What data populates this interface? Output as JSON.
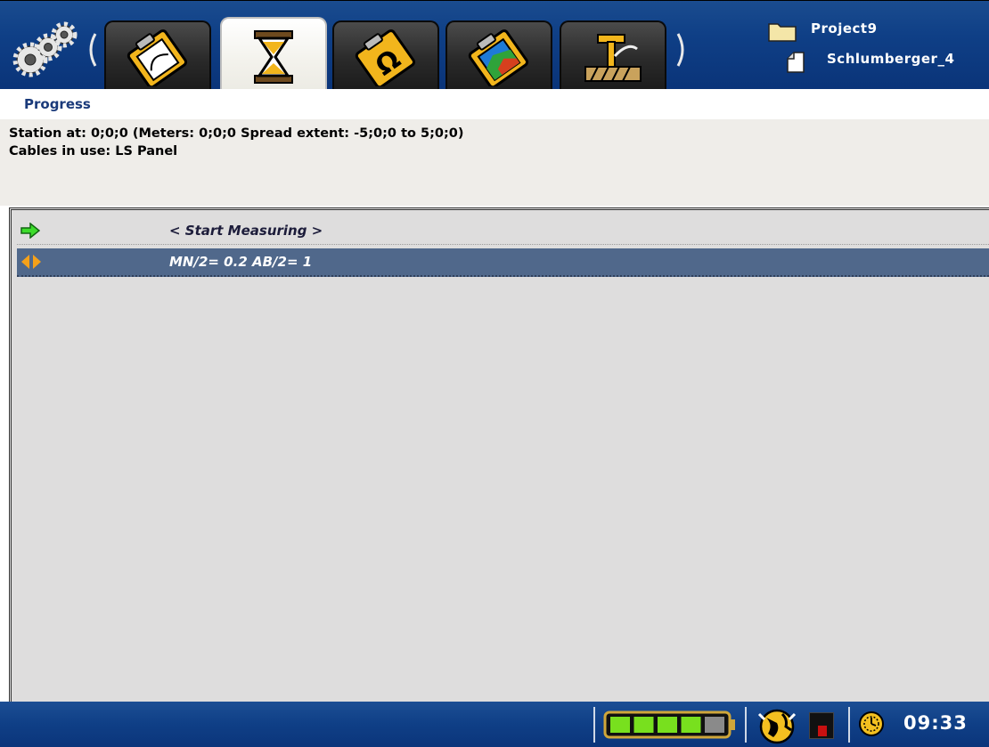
{
  "header": {
    "project_name": "Project9",
    "file_name": "Schlumberger_4",
    "tabs": [
      {
        "icon": "clipboard-curve-icon",
        "active": false
      },
      {
        "icon": "hourglass-icon",
        "active": true
      },
      {
        "icon": "clipboard-ohm-icon",
        "active": false
      },
      {
        "icon": "clipboard-map-icon",
        "active": false
      },
      {
        "icon": "electrode-stake-icon",
        "active": false
      }
    ]
  },
  "page": {
    "title": "Progress",
    "station_line": "Station at: 0;0;0 (Meters: 0;0;0 Spread extent: -5;0;0 to 5;0;0)",
    "cables_line": "Cables in use: LS Panel"
  },
  "list": {
    "rows": [
      {
        "label": "< Start Measuring >",
        "icon": "green-arrow-icon",
        "selected": false
      },
      {
        "label": "MN/2= 0.2 AB/2= 1",
        "icon": "orange-diamond-icon",
        "selected": true
      }
    ]
  },
  "statusbar": {
    "battery_level_segments": 4,
    "battery_total_segments": 5,
    "time": "09:33"
  },
  "colors": {
    "header_blue": "#0f3f86",
    "title_blue": "#1a3a7a",
    "selected_row": "#50688b",
    "battery_green": "#78e01e"
  }
}
